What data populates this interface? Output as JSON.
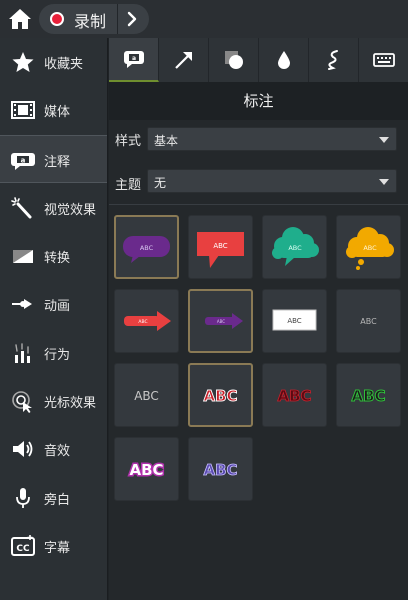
{
  "toolbar": {
    "record_label": "录制"
  },
  "sidebar": {
    "items": [
      {
        "label": "收藏夹",
        "icon": "star-icon"
      },
      {
        "label": "媒体",
        "icon": "film-icon"
      },
      {
        "label": "注释",
        "icon": "annotation-icon"
      },
      {
        "label": "视觉效果",
        "icon": "magic-wand-icon"
      },
      {
        "label": "转换",
        "icon": "transition-icon"
      },
      {
        "label": "动画",
        "icon": "animation-arrow-icon"
      },
      {
        "label": "行为",
        "icon": "behavior-icon"
      },
      {
        "label": "光标效果",
        "icon": "cursor-effect-icon"
      },
      {
        "label": "音效",
        "icon": "speaker-icon"
      },
      {
        "label": "旁白",
        "icon": "microphone-icon"
      },
      {
        "label": "字幕",
        "icon": "cc-caption-icon"
      }
    ],
    "active_index": 2
  },
  "tabs": [
    {
      "icon": "callout-tab-icon",
      "active": true
    },
    {
      "icon": "arrow-tab-icon",
      "active": false
    },
    {
      "icon": "shape-tab-icon",
      "active": false
    },
    {
      "icon": "blur-drop-tab-icon",
      "active": false
    },
    {
      "icon": "sketch-motion-tab-icon",
      "active": false
    },
    {
      "icon": "keystroke-tab-icon",
      "active": false
    }
  ],
  "panel": {
    "title": "标注",
    "style_label": "样式",
    "style_value": "基本",
    "theme_label": "主题",
    "theme_value": "无"
  },
  "callouts": [
    {
      "kind": "purple-speech-bubble",
      "text": "ABC",
      "selected": true
    },
    {
      "kind": "red-speech-bubble",
      "text": "ABC",
      "selected": false
    },
    {
      "kind": "green-cloud-bubble",
      "text": "ABC",
      "selected": false
    },
    {
      "kind": "yellow-thought-bubble",
      "text": "ABC",
      "selected": false
    },
    {
      "kind": "red-arrow",
      "text": "ABC",
      "selected": false
    },
    {
      "kind": "purple-arrow",
      "text": "ABC",
      "selected": true
    },
    {
      "kind": "white-box",
      "text": "ABC",
      "selected": false
    },
    {
      "kind": "plain-text",
      "text": "ABC",
      "selected": false
    },
    {
      "kind": "text-light",
      "text": "ABC",
      "selected": false
    },
    {
      "kind": "text-red-outline",
      "text": "ABC",
      "selected": true
    },
    {
      "kind": "text-dark-red",
      "text": "ABC",
      "selected": false
    },
    {
      "kind": "text-green-outline",
      "text": "ABC",
      "selected": false
    },
    {
      "kind": "text-pink-glow",
      "text": "ABC",
      "selected": false
    },
    {
      "kind": "text-purple-outline",
      "text": "ABC",
      "selected": false
    }
  ],
  "colors": {
    "accent_green": "#6f8f2f",
    "record_red": "#e8203a",
    "selection_border": "#8a7a55"
  }
}
